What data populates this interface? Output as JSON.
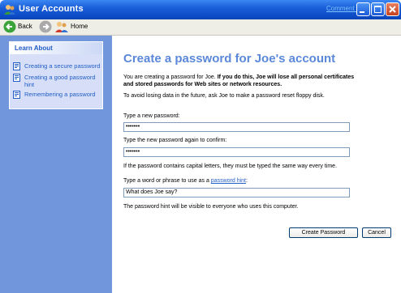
{
  "window": {
    "title": "User Accounts",
    "comment_link": "Comment 1"
  },
  "toolbar": {
    "back_label": "Back",
    "home_label": "Home"
  },
  "sidebar": {
    "learn_about_title": "Learn About",
    "items": [
      {
        "label": "Creating a secure password",
        "icon": "help-topic-icon"
      },
      {
        "label": "Creating a good password hint",
        "icon": "help-topic-icon"
      },
      {
        "label": "Remembering a password",
        "icon": "help-topic-icon"
      }
    ]
  },
  "main": {
    "heading": "Create a password for Joe's account",
    "warning_normal": "You are creating a password for Joe. ",
    "warning_bold": "If you do this, Joe will lose all personal certificates and stored passwords for Web sites or network resources.",
    "avoid_text": "To avoid losing data in the future, ask Joe to make a password reset floppy disk.",
    "new_password_label": "Type a new password:",
    "new_password_value": "•••••••",
    "confirm_label": "Type the new password again to confirm:",
    "confirm_value": "•••••••",
    "caps_text": "If the password contains capital letters, they must be typed the same way every time.",
    "hint_label_prefix": "Type a word or phrase to use as a ",
    "hint_link": "password hint",
    "hint_label_suffix": ":",
    "hint_value": "What does Joe say?",
    "visible_text": "The password hint will be visible to everyone who uses this computer.",
    "create_button": "Create Password",
    "cancel_button": "Cancel"
  },
  "colors": {
    "titlebar": "#0d4cc7",
    "sidebar": "#7296dc",
    "heading": "#5b88d8",
    "link": "#215dc6"
  }
}
